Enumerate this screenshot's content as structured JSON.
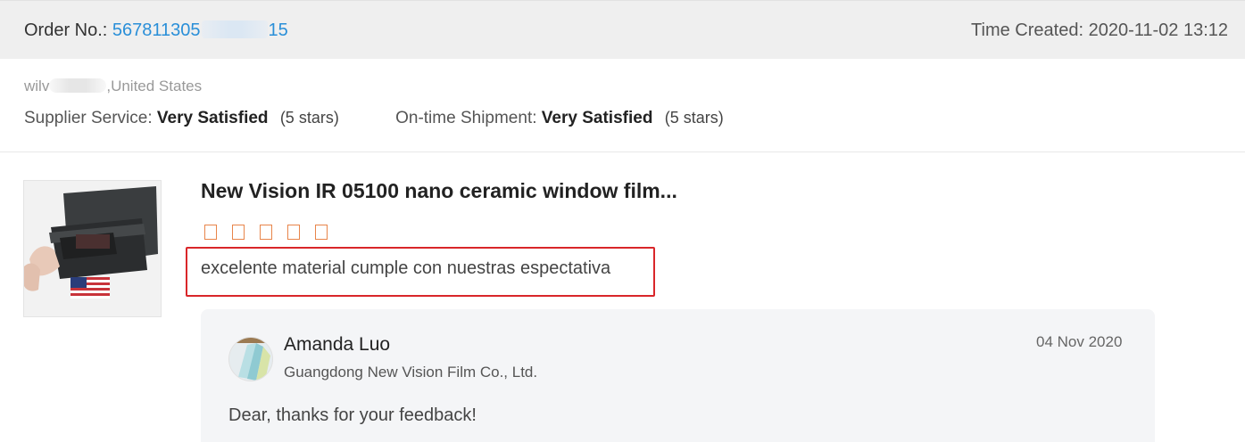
{
  "order": {
    "label": "Order No.:",
    "number_start": "567811305",
    "number_end": "15",
    "time_created": "Time Created: 2020-11-02 13:12"
  },
  "buyer": {
    "name_prefix": "wilv",
    "location": ",United States"
  },
  "ratings": {
    "supplier_service": {
      "label": "Supplier Service:",
      "value": "Very Satisfied",
      "stars_text": "(5 stars)",
      "stars": 5
    },
    "ontime_shipment": {
      "label": "On-time Shipment:",
      "value": "Very Satisfied",
      "stars_text": "(5 stars)",
      "stars": 5
    }
  },
  "product": {
    "title": "New Vision IR 05100 nano ceramic window film...",
    "rating": 5,
    "review": "excelente material cumple con nuestras espectativa"
  },
  "reply": {
    "name": "Amanda Luo",
    "company": "Guangdong New Vision Film Co., Ltd.",
    "date": "04 Nov 2020",
    "message": "Dear, thanks for your feedback!"
  },
  "colors": {
    "link_blue": "#2a8fd8",
    "star_orange": "#e8854a",
    "highlight_red": "#d9262a",
    "header_bg": "#efefef",
    "reply_bg": "#f4f5f7"
  }
}
